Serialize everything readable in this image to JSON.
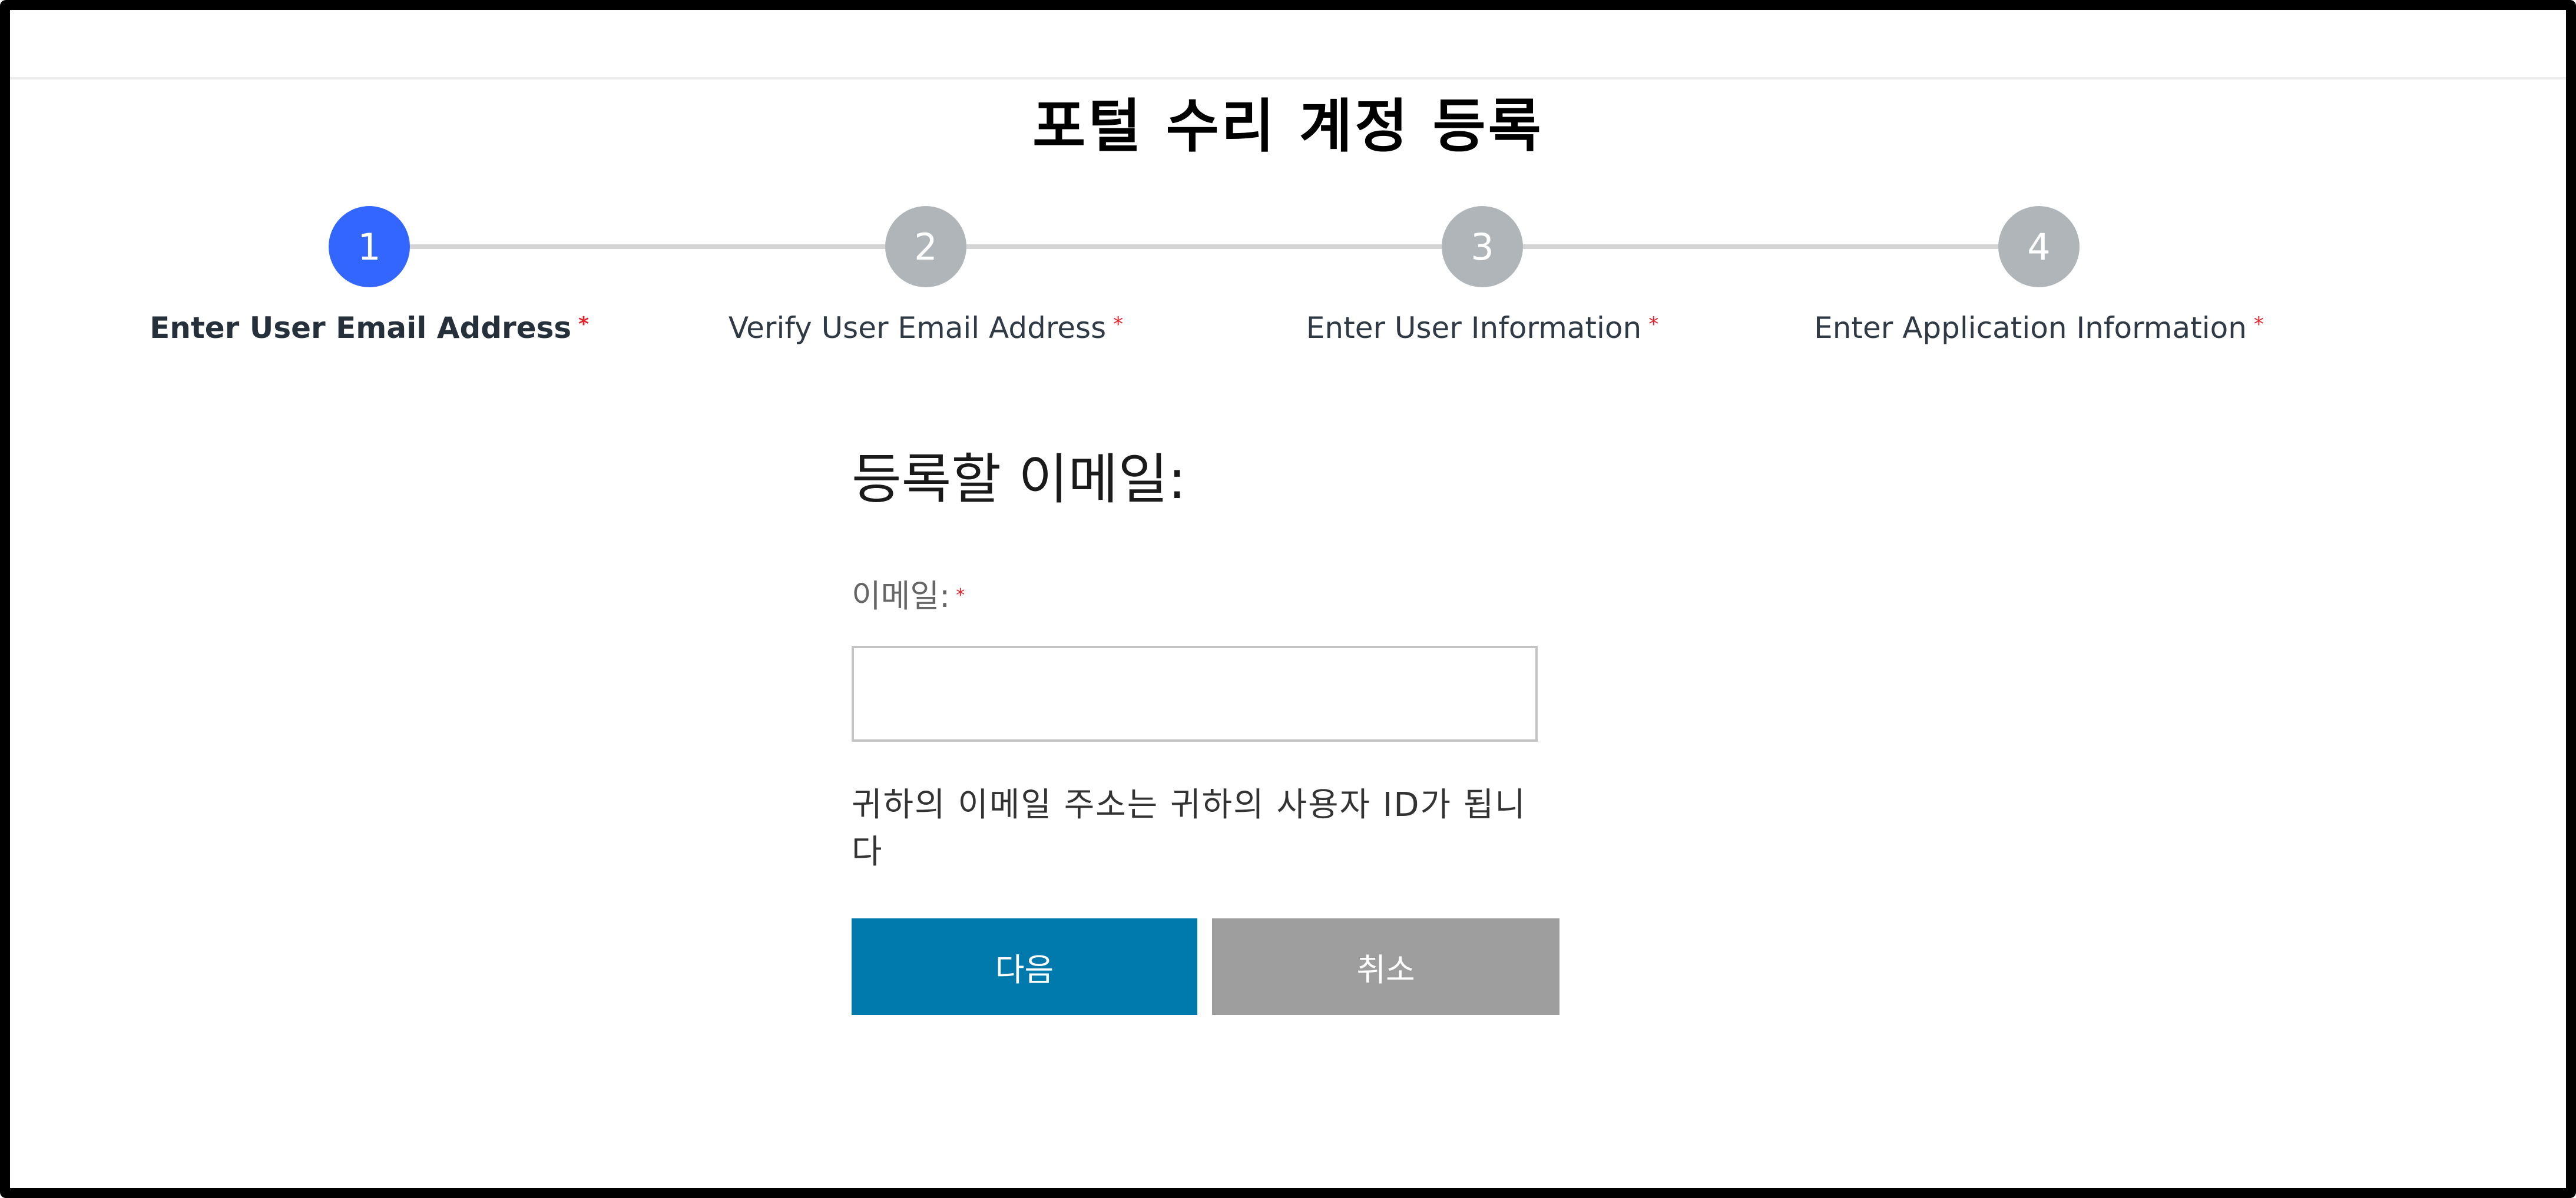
{
  "page": {
    "title": "포털 수리 계정 등록"
  },
  "stepper": {
    "active_color": "#3366ff",
    "inactive_color": "#b0b5b9",
    "required_marker": "*",
    "steps": [
      {
        "number": "1",
        "label": "Enter User Email Address",
        "state": "active"
      },
      {
        "number": "2",
        "label": "Verify User Email Address",
        "state": "inactive"
      },
      {
        "number": "3",
        "label": "Enter User Information",
        "state": "inactive"
      },
      {
        "number": "4",
        "label": "Enter Application Information",
        "state": "inactive"
      }
    ]
  },
  "form": {
    "heading": "등록할 이메일:",
    "email_label": "이메일:",
    "required_marker": "*",
    "email_value": "",
    "email_placeholder": "",
    "help_text": "귀하의 이메일 주소는 귀하의 사용자 ID가 됩니다",
    "next_label": "다음",
    "cancel_label": "취소",
    "next_color": "#007aad",
    "cancel_color": "#9e9e9e"
  }
}
